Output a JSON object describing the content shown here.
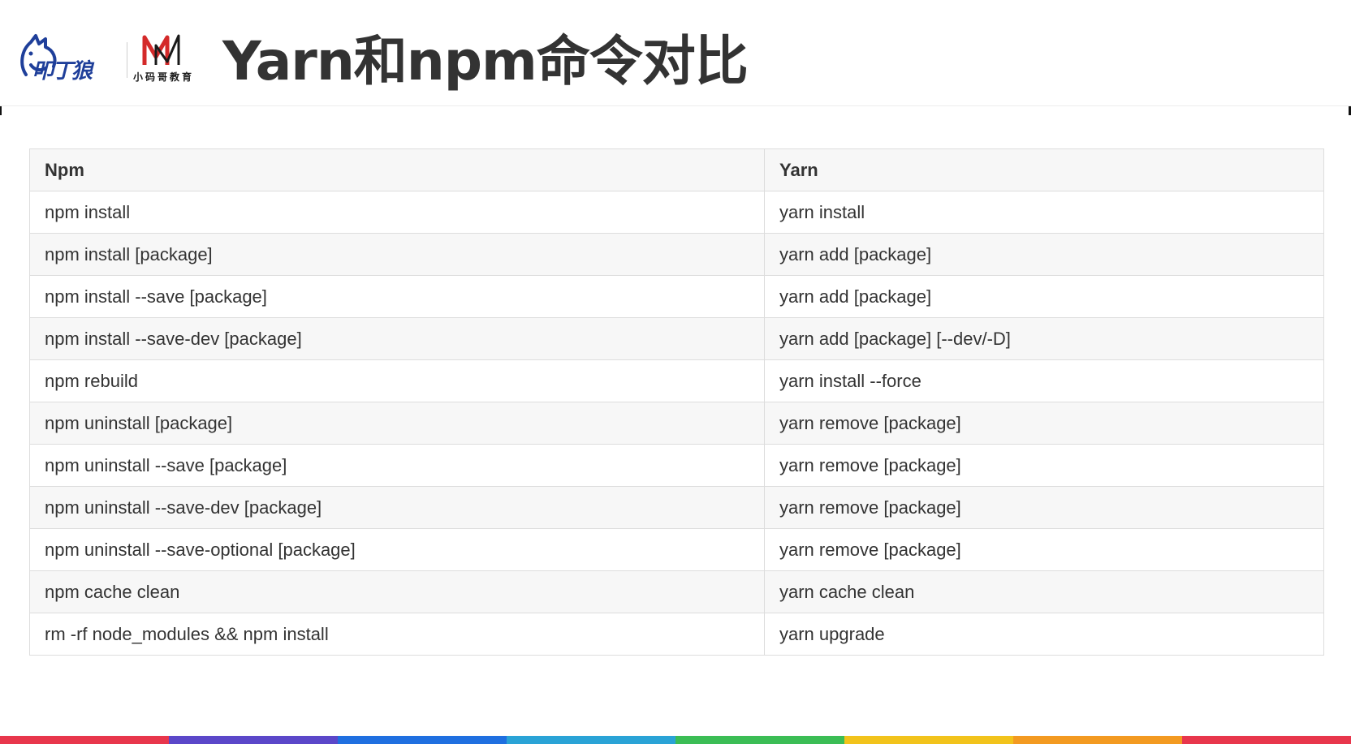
{
  "header": {
    "title": "Yarn和npm命令对比",
    "logo_left_text": "叩丁狼",
    "logo_right_text": "小码哥教育"
  },
  "table": {
    "columns": [
      "Npm",
      "Yarn"
    ],
    "rows": [
      [
        "npm install",
        "yarn install"
      ],
      [
        "npm install [package]",
        "yarn add [package]"
      ],
      [
        "npm install --save [package]",
        "yarn add [package]"
      ],
      [
        "npm install --save-dev [package]",
        "yarn add [package] [--dev/-D]"
      ],
      [
        "npm rebuild",
        "yarn install --force"
      ],
      [
        "npm uninstall [package]",
        "yarn remove [package]"
      ],
      [
        "npm uninstall --save [package]",
        "yarn remove [package]"
      ],
      [
        "npm uninstall --save-dev [package]",
        "yarn remove [package]"
      ],
      [
        "npm uninstall --save-optional [package]",
        "yarn remove [package]"
      ],
      [
        "npm cache clean",
        "yarn cache clean"
      ],
      [
        "rm -rf node_modules && npm install",
        "yarn upgrade"
      ]
    ]
  },
  "colors": {
    "brand_blue": "#1f3f9a",
    "brand_red": "#d42a2a",
    "title_text": "#333333",
    "rainbow": [
      "#e8364c",
      "#5b47c9",
      "#1f6fe0",
      "#2aa3d6",
      "#3bbd55",
      "#f2c31b",
      "#f39a21",
      "#e8364c"
    ]
  }
}
